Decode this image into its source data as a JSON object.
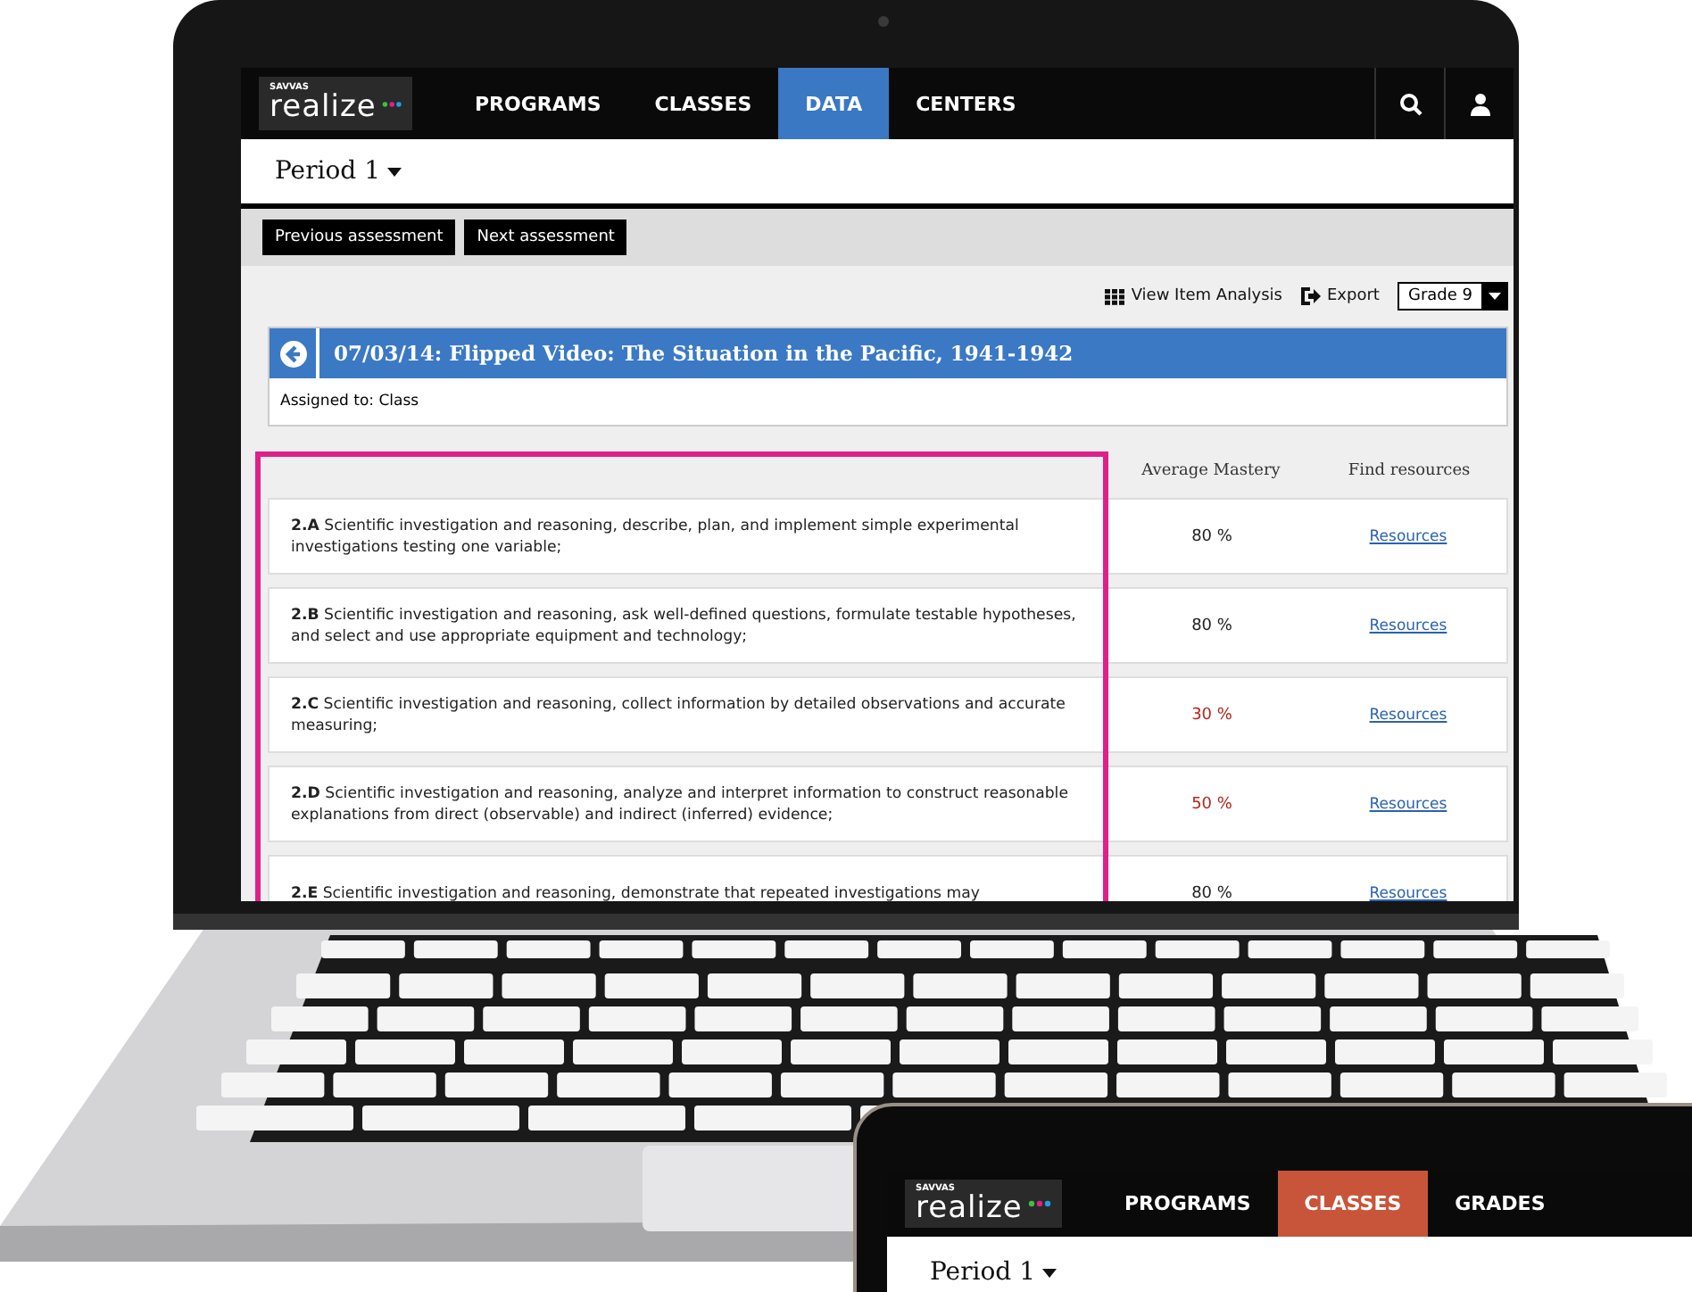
{
  "laptop": {
    "nav": {
      "logo": {
        "brand": "SAVVAS",
        "name": "realize"
      },
      "tabs": [
        {
          "label": "PROGRAMS",
          "selected": false
        },
        {
          "label": "CLASSES",
          "selected": false
        },
        {
          "label": "DATA",
          "selected": true
        },
        {
          "label": "CENTERS",
          "selected": false
        }
      ]
    },
    "header": {
      "title": "Period 1"
    },
    "toolbar": {
      "buttons": [
        "Previous assessment",
        "Next assessment"
      ]
    },
    "actions": {
      "item_analysis": "View Item Analysis",
      "export": "Export",
      "grade": "Grade 9"
    },
    "assessment": {
      "title": "07/03/14: Flipped Video: The Situation in the Pacific, 1941-1942",
      "assigned": "Assigned to: Class"
    },
    "table": {
      "columns": [
        "Average Mastery",
        "Find resources"
      ],
      "rows": [
        {
          "text": "**2.A** Scientific investigation and reasoning, describe, plan, and implement simple experimental investigations testing one variable;",
          "mastery": "80 %",
          "below_target": false,
          "link": "Resources"
        },
        {
          "text": "**2.B** Scientific investigation and reasoning, ask well-defined questions, formulate testable hypotheses, and select and use appropriate equipment and technology;",
          "mastery": "80 %",
          "below_target": false,
          "link": "Resources"
        },
        {
          "text": "**2.C** Scientific investigation and reasoning, collect information by detailed observations and accurate measuring;",
          "mastery": "30 %",
          "below_target": true,
          "link": "Resources"
        },
        {
          "text": "**2.D** Scientific investigation and reasoning, analyze and interpret information to construct reasonable explanations from direct (observable) and indirect (inferred) evidence;",
          "mastery": "50 %",
          "below_target": true,
          "link": "Resources"
        },
        {
          "text": "**2.E** Scientific investigation and reasoning, demonstrate that repeated investigations may",
          "mastery": "80 %",
          "below_target": false,
          "link": "Resources"
        }
      ]
    }
  },
  "tablet": {
    "nav": {
      "logo": {
        "brand": "SAVVAS",
        "name": "realize"
      },
      "tabs": [
        {
          "label": "PROGRAMS",
          "selected": false
        },
        {
          "label": "CLASSES",
          "selected": true
        },
        {
          "label": "GRADES",
          "selected": false
        }
      ]
    },
    "header": {
      "title": "Period 1"
    }
  }
}
